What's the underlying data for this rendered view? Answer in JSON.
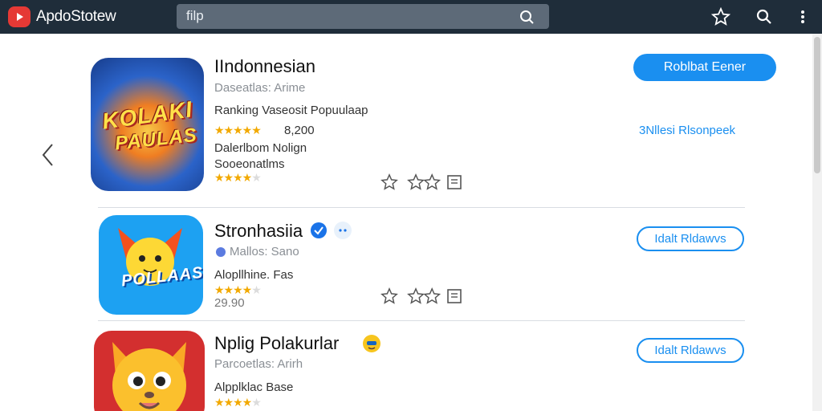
{
  "header": {
    "app_name": "ApdoStotew",
    "search_value": "filp",
    "icons": [
      "search-icon",
      "star-icon",
      "search-icon",
      "more-icon"
    ]
  },
  "colors": {
    "topbar": "#1f2d3a",
    "accent": "#1a8ff0",
    "star": "#f2a900"
  },
  "apps": [
    {
      "title": "IIndonnesian",
      "art_text": [
        "KOLAKI",
        "PAULAS"
      ],
      "subtitle": "Daseatlas: Arime",
      "line1": "Ranking Vaseosit Popuulaap",
      "rating_count": "8,200",
      "line2": "Dalerlbom Nolign",
      "line3": "Sooeonatlms",
      "primary_button": "Roblbat Eener",
      "secondary_link": "3Nllesi Rlsonpeek"
    },
    {
      "title": "Stronhasiia",
      "art_text": [
        "POLLAAS"
      ],
      "subtitle": "Mallos: Sano",
      "line1": "Alopllhine. Fas",
      "rating_count": "29.90",
      "outline_button": "Idalt Rldawvs"
    },
    {
      "title": "Nplig Polakurlar",
      "subtitle": "Parcoetlas: Arirh",
      "line1": "Alpplklac Base",
      "outline_button": "Idalt Rldawvs"
    }
  ]
}
